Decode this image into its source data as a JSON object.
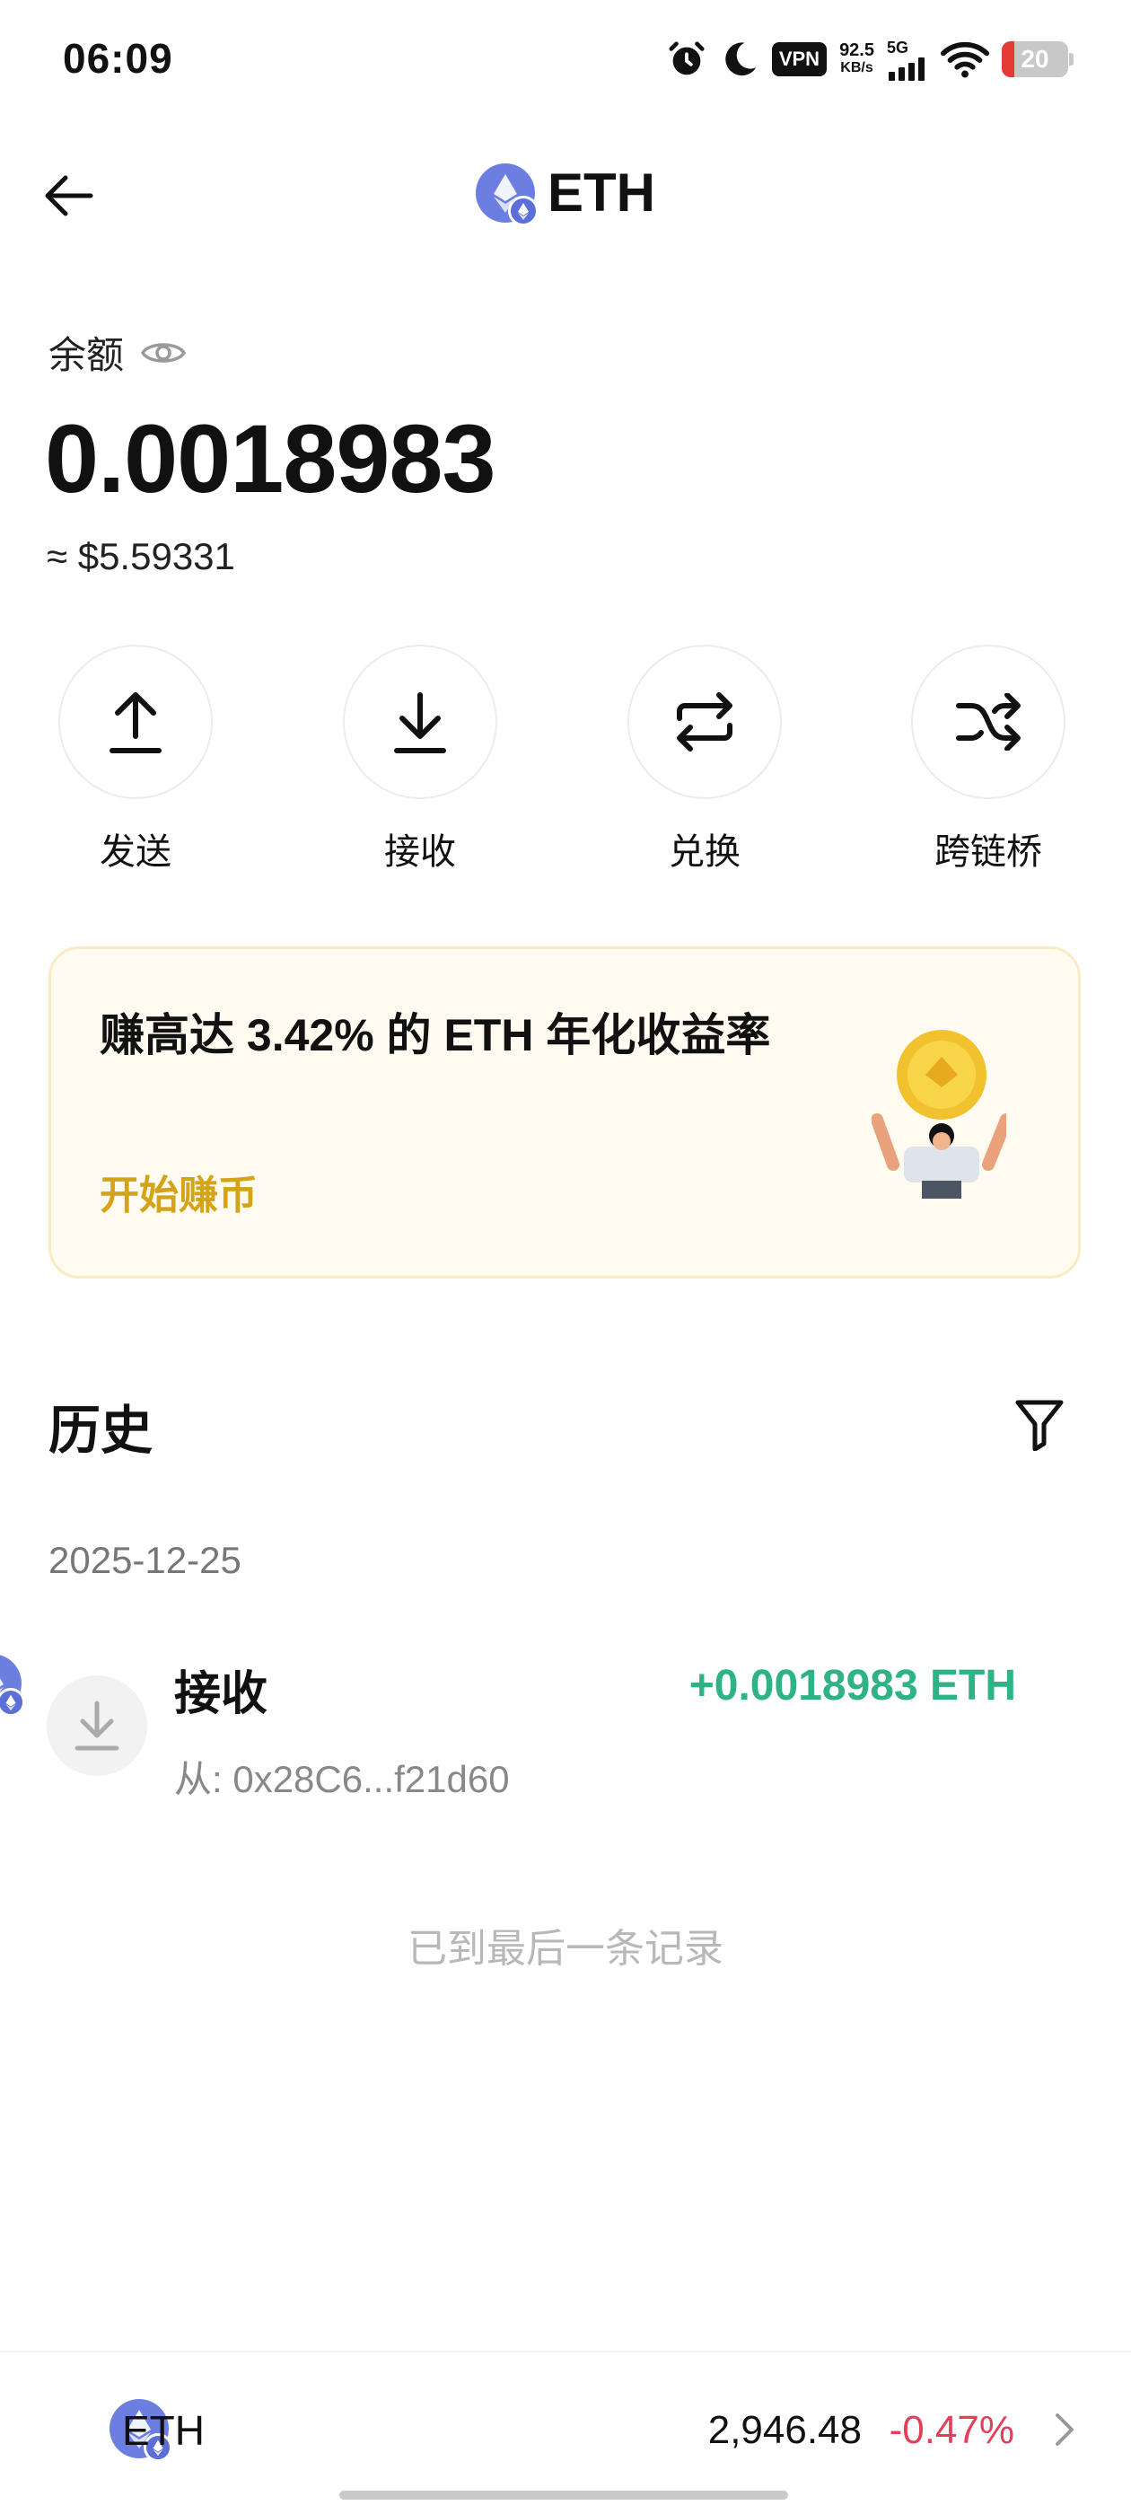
{
  "status_bar": {
    "time": "06:09",
    "vpn": "VPN",
    "speed_value": "92.5",
    "speed_unit": "KB/s",
    "network": "5G",
    "battery": "20",
    "icons": [
      "alarm-icon",
      "moon-icon",
      "signal-icon",
      "wifi-icon",
      "battery-icon"
    ]
  },
  "header": {
    "title": "ETH",
    "back_icon": "back-arrow-icon",
    "coin_icon": "eth-coin-icon"
  },
  "balance": {
    "label": "余额",
    "amount": "0.0018983",
    "usd": "≈ $5.59331"
  },
  "actions": [
    {
      "label": "发送",
      "icon": "upload-arrow-icon"
    },
    {
      "label": "接收",
      "icon": "download-arrow-icon"
    },
    {
      "label": "兑换",
      "icon": "swap-icon"
    },
    {
      "label": "跨链桥",
      "icon": "shuffle-icon"
    }
  ],
  "promo": {
    "text": "赚高达 3.42% 的 ETH 年化收益率",
    "link": "开始赚币"
  },
  "history": {
    "title": "历史",
    "date": "2025-12-25",
    "transactions": [
      {
        "type": "接收",
        "from": "从: 0x28C6...f21d60",
        "amount": "+0.0018983 ETH"
      }
    ],
    "end_note": "已到最后一条记录"
  },
  "bottom_bar": {
    "coin": "ETH",
    "price": "2,946.48",
    "change": "-0.47%"
  },
  "colors": {
    "positive": "#2eb286",
    "negative": "#e0405a",
    "accent_gold": "#d4a317",
    "eth_purple": "#6c7fe0"
  }
}
